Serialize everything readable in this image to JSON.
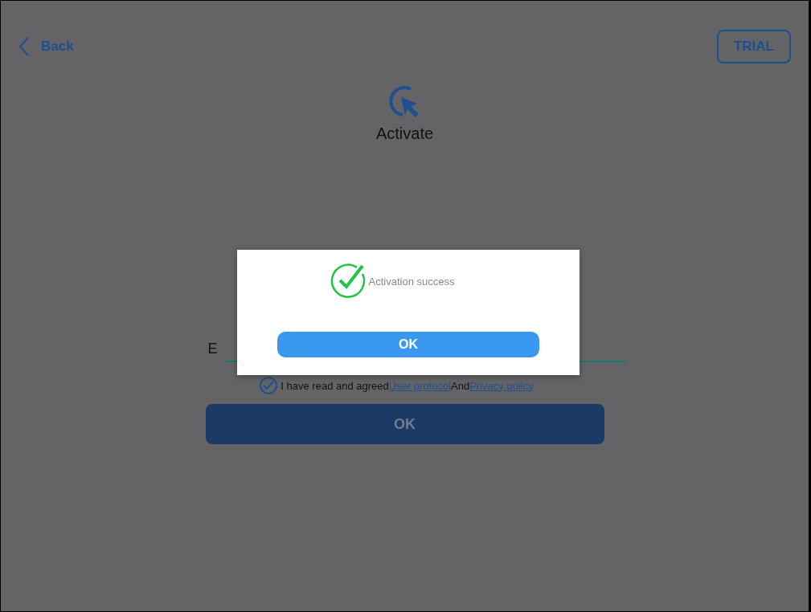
{
  "header": {
    "back": "Back",
    "trial": "TRIAL"
  },
  "title": "Activate",
  "field": {
    "label": "E"
  },
  "agreement": {
    "checked": true,
    "prefix": "I have read and agreed",
    "link1": "User protocol",
    "joiner": "And",
    "link2": "Privacy policy"
  },
  "submit": "OK",
  "dialog": {
    "message": "Activation success",
    "button": "OK"
  }
}
